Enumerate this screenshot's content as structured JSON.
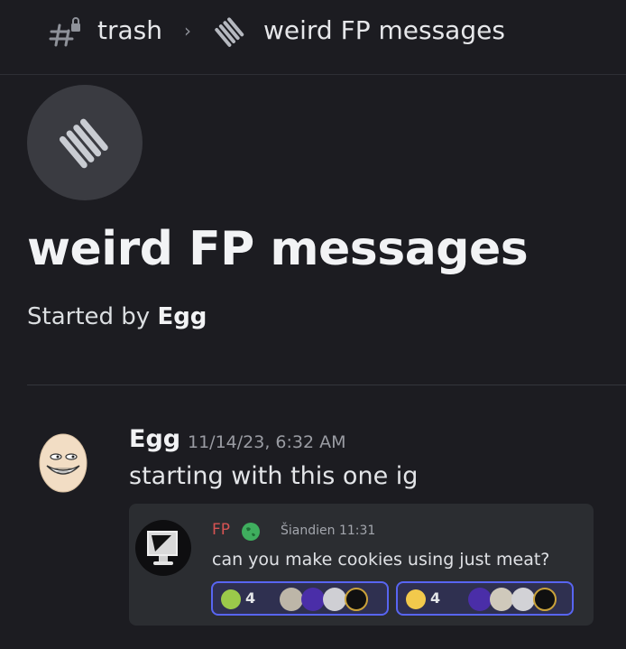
{
  "breadcrumb": {
    "channel": "trash",
    "separator": "›",
    "thread": "weird FP messages"
  },
  "thread": {
    "title": "weird FP messages",
    "started_by_prefix": "Started by",
    "started_by_user": "Egg"
  },
  "message": {
    "author": "Egg",
    "timestamp": "11/14/23, 6:32 AM",
    "text": "starting with this one ig"
  },
  "embed": {
    "author": "FP",
    "time": "Šiandien 11:31",
    "text": "can you make cookies using just meat?",
    "author_color": "#d65353",
    "reactions": [
      {
        "emoji_icon": "nauseated-face-icon",
        "count": "4"
      },
      {
        "emoji_icon": "dizzy-face-icon",
        "count": "4"
      }
    ]
  },
  "colors": {
    "background": "#1c1c21",
    "reaction_border": "#5865f2"
  }
}
